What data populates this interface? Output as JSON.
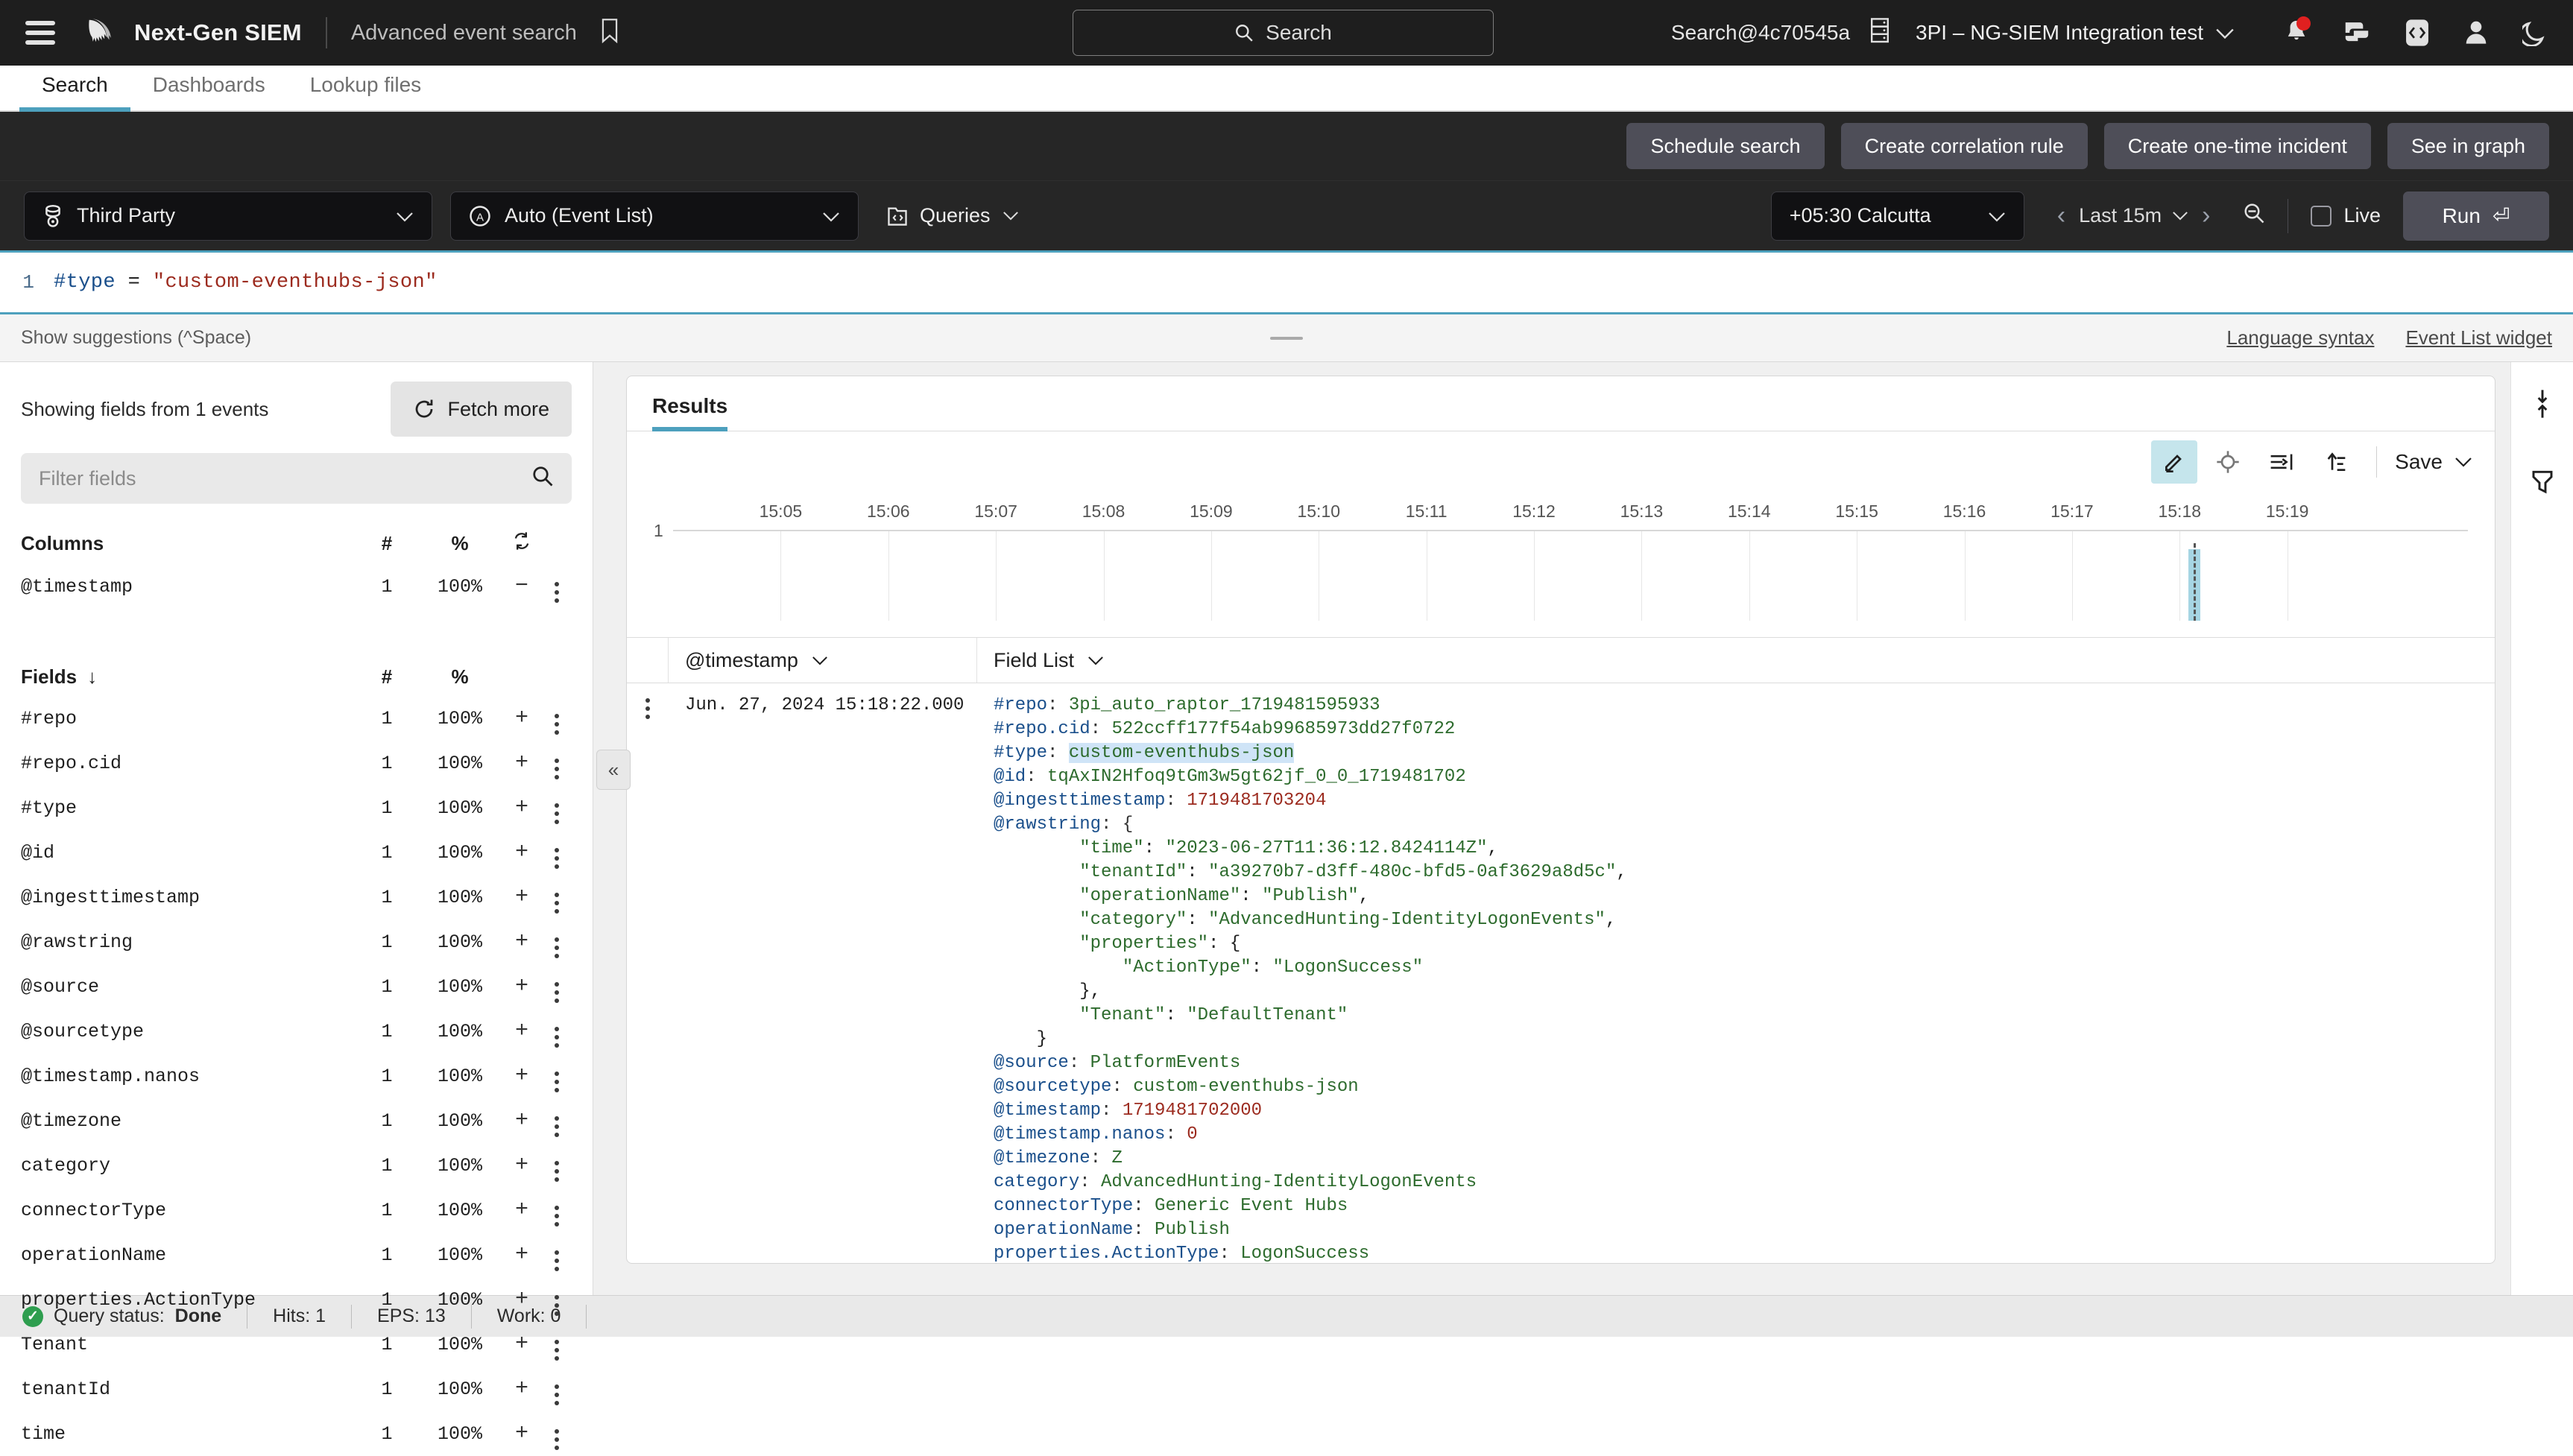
{
  "header": {
    "menu_icon": "hamburger-menu-icon",
    "logo_icon": "crowdstrike-logo-icon",
    "product_title": "Next-Gen SIEM",
    "page_subtitle": "Advanced event search",
    "bookmark_icon": "bookmark-icon",
    "search_placeholder": "Search",
    "search_icon": "search-icon",
    "account": "Search@4c70545a",
    "server_icon": "server-icon",
    "tenant": "3PI – NG-SIEM Integration test",
    "icons": [
      "notifications-bell-icon",
      "chat-icon",
      "code-icon",
      "user-avatar-icon",
      "dark-mode-moon-icon"
    ]
  },
  "tabs": [
    {
      "label": "Search",
      "active": true
    },
    {
      "label": "Dashboards",
      "active": false
    },
    {
      "label": "Lookup files",
      "active": false
    }
  ],
  "actions": [
    {
      "label": "Schedule search"
    },
    {
      "label": "Create correlation rule"
    },
    {
      "label": "Create one-time incident"
    },
    {
      "label": "See in graph"
    }
  ],
  "querybar": {
    "repository": "Third Party",
    "view_mode": "Auto (Event List)",
    "queries_label": "Queries",
    "timezone": "+05:30 Calcutta",
    "time_range": "Last 15m",
    "live_label": "Live",
    "run_label": "Run",
    "run_glyph": "⏎"
  },
  "editor": {
    "line_number": "1",
    "field_token": "#type",
    "operator_token": "=",
    "value_token": "\"custom-eventhubs-json\"",
    "suggestions_hint": "Show suggestions (^Space)",
    "link_language_syntax": "Language syntax",
    "link_event_list_widget": "Event List widget"
  },
  "fields_panel": {
    "summary": "Showing fields from 1 events",
    "fetch_more_label": "Fetch more",
    "filter_placeholder": "Filter fields",
    "columns_header": {
      "name": "Columns",
      "count": "#",
      "percent": "%"
    },
    "columns": [
      {
        "name": "@timestamp",
        "count": "1",
        "percent": "100%",
        "action": "−"
      }
    ],
    "fields_header": {
      "name": "Fields",
      "sort_glyph": "↓",
      "count": "#",
      "percent": "%"
    },
    "fields": [
      {
        "name": "#repo",
        "count": "1",
        "percent": "100%",
        "action": "+"
      },
      {
        "name": "#repo.cid",
        "count": "1",
        "percent": "100%",
        "action": "+"
      },
      {
        "name": "#type",
        "count": "1",
        "percent": "100%",
        "action": "+"
      },
      {
        "name": "@id",
        "count": "1",
        "percent": "100%",
        "action": "+"
      },
      {
        "name": "@ingesttimestamp",
        "count": "1",
        "percent": "100%",
        "action": "+"
      },
      {
        "name": "@rawstring",
        "count": "1",
        "percent": "100%",
        "action": "+"
      },
      {
        "name": "@source",
        "count": "1",
        "percent": "100%",
        "action": "+"
      },
      {
        "name": "@sourcetype",
        "count": "1",
        "percent": "100%",
        "action": "+"
      },
      {
        "name": "@timestamp.nanos",
        "count": "1",
        "percent": "100%",
        "action": "+"
      },
      {
        "name": "@timezone",
        "count": "1",
        "percent": "100%",
        "action": "+"
      },
      {
        "name": "category",
        "count": "1",
        "percent": "100%",
        "action": "+"
      },
      {
        "name": "connectorType",
        "count": "1",
        "percent": "100%",
        "action": "+"
      },
      {
        "name": "operationName",
        "count": "1",
        "percent": "100%",
        "action": "+"
      },
      {
        "name": "properties.ActionType",
        "count": "1",
        "percent": "100%",
        "action": "+"
      },
      {
        "name": "Tenant",
        "count": "1",
        "percent": "100%",
        "action": "+"
      },
      {
        "name": "tenantId",
        "count": "1",
        "percent": "100%",
        "action": "+"
      },
      {
        "name": "time",
        "count": "1",
        "percent": "100%",
        "action": "+"
      }
    ]
  },
  "results": {
    "tab_label": "Results",
    "toolbar_icons": [
      "annotate-pencil-icon",
      "target-crosshair-icon",
      "wrap-text-icon",
      "sort-ascending-icon"
    ],
    "save_label": "Save",
    "table_headers": {
      "timestamp": "@timestamp",
      "field_list": "Field List"
    },
    "row": {
      "timestamp": "Jun. 27, 2024 15:18:22.000"
    }
  },
  "chart_data": {
    "type": "bar",
    "title": "",
    "xlabel": "",
    "ylabel": "",
    "ylim": [
      0,
      1
    ],
    "y_ticks": [
      "1"
    ],
    "x_ticks": [
      "15:05",
      "15:06",
      "15:07",
      "15:08",
      "15:09",
      "15:10",
      "15:11",
      "15:12",
      "15:13",
      "15:14",
      "15:15",
      "15:16",
      "15:17",
      "15:18",
      "15:19"
    ],
    "categories": [
      "15:18:22"
    ],
    "values": [
      1
    ],
    "bar_color": "#a6d5e3",
    "grid": true,
    "legend": "none"
  },
  "event": {
    "lines": [
      {
        "key": "#repo",
        "value": "3pi_auto_raptor_1719481595933",
        "type": "string",
        "indent": 0
      },
      {
        "key": "#repo.cid",
        "value": "522ccff177f54ab99685973dd27f0722",
        "type": "string",
        "indent": 0
      },
      {
        "key": "#type",
        "value": "custom-eventhubs-json",
        "type": "string",
        "indent": 0,
        "highlight": true
      },
      {
        "key": "@id",
        "value": "tqAxIN2Hfoq9tGm3w5gt62jf_0_0_1719481702",
        "type": "string",
        "indent": 0
      },
      {
        "key": "@ingesttimestamp",
        "value": "1719481703204",
        "type": "number",
        "indent": 0
      },
      {
        "key": "@rawstring",
        "value": "{",
        "type": "plain",
        "indent": 0
      },
      {
        "key": "",
        "raw": "\"time\": \"2023-06-27T11:36:12.8424114Z\",",
        "type": "json",
        "indent": 2
      },
      {
        "key": "",
        "raw": "\"tenantId\": \"a39270b7-d3ff-480c-bfd5-0af3629a8d5c\",",
        "type": "json",
        "indent": 2
      },
      {
        "key": "",
        "raw": "\"operationName\": \"Publish\",",
        "type": "json",
        "indent": 2
      },
      {
        "key": "",
        "raw": "\"category\": \"AdvancedHunting-IdentityLogonEvents\",",
        "type": "json",
        "indent": 2
      },
      {
        "key": "",
        "raw": "\"properties\": {",
        "type": "json",
        "indent": 2
      },
      {
        "key": "",
        "raw": "\"ActionType\": \"LogonSuccess\"",
        "type": "json",
        "indent": 3
      },
      {
        "key": "",
        "raw": "},",
        "type": "plain",
        "indent": 2
      },
      {
        "key": "",
        "raw": "\"Tenant\": \"DefaultTenant\"",
        "type": "json",
        "indent": 2
      },
      {
        "key": "",
        "raw": "}",
        "type": "plain",
        "indent": 1
      },
      {
        "key": "@source",
        "value": "PlatformEvents",
        "type": "string",
        "indent": 0
      },
      {
        "key": "@sourcetype",
        "value": "custom-eventhubs-json",
        "type": "string",
        "indent": 0
      },
      {
        "key": "@timestamp",
        "value": "1719481702000",
        "type": "number",
        "indent": 0
      },
      {
        "key": "@timestamp.nanos",
        "value": "0",
        "type": "number",
        "indent": 0
      },
      {
        "key": "@timezone",
        "value": "Z",
        "type": "string",
        "indent": 0
      },
      {
        "key": "category",
        "value": "AdvancedHunting-IdentityLogonEvents",
        "type": "string",
        "indent": 0
      },
      {
        "key": "connectorType",
        "value": "Generic Event Hubs",
        "type": "string",
        "indent": 0
      },
      {
        "key": "operationName",
        "value": "Publish",
        "type": "string",
        "indent": 0
      },
      {
        "key": "properties.ActionType",
        "value": "LogonSuccess",
        "type": "string",
        "indent": 0
      },
      {
        "key": "Tenant",
        "value": "DefaultTenant",
        "type": "string",
        "indent": 0
      },
      {
        "key": "tenantId",
        "value": "a39270b7-d3ff-480c-bfd5-0af3629a8d5c",
        "type": "string",
        "indent": 0
      },
      {
        "key": "time",
        "value": "2023-06-27T11:36:12.8424114Z",
        "type": "string",
        "indent": 0
      }
    ]
  },
  "statusbar": {
    "query_status_label": "Query status:",
    "query_status_value": "Done",
    "hits": "Hits: 1",
    "eps": "EPS: 13",
    "work": "Work: 0"
  },
  "rail": {
    "collapse_icon": "collapse-panel-icon",
    "expand_collapse_icon": "expand-collapse-arrows-icon",
    "filter_icon": "filter-funnel-icon"
  }
}
